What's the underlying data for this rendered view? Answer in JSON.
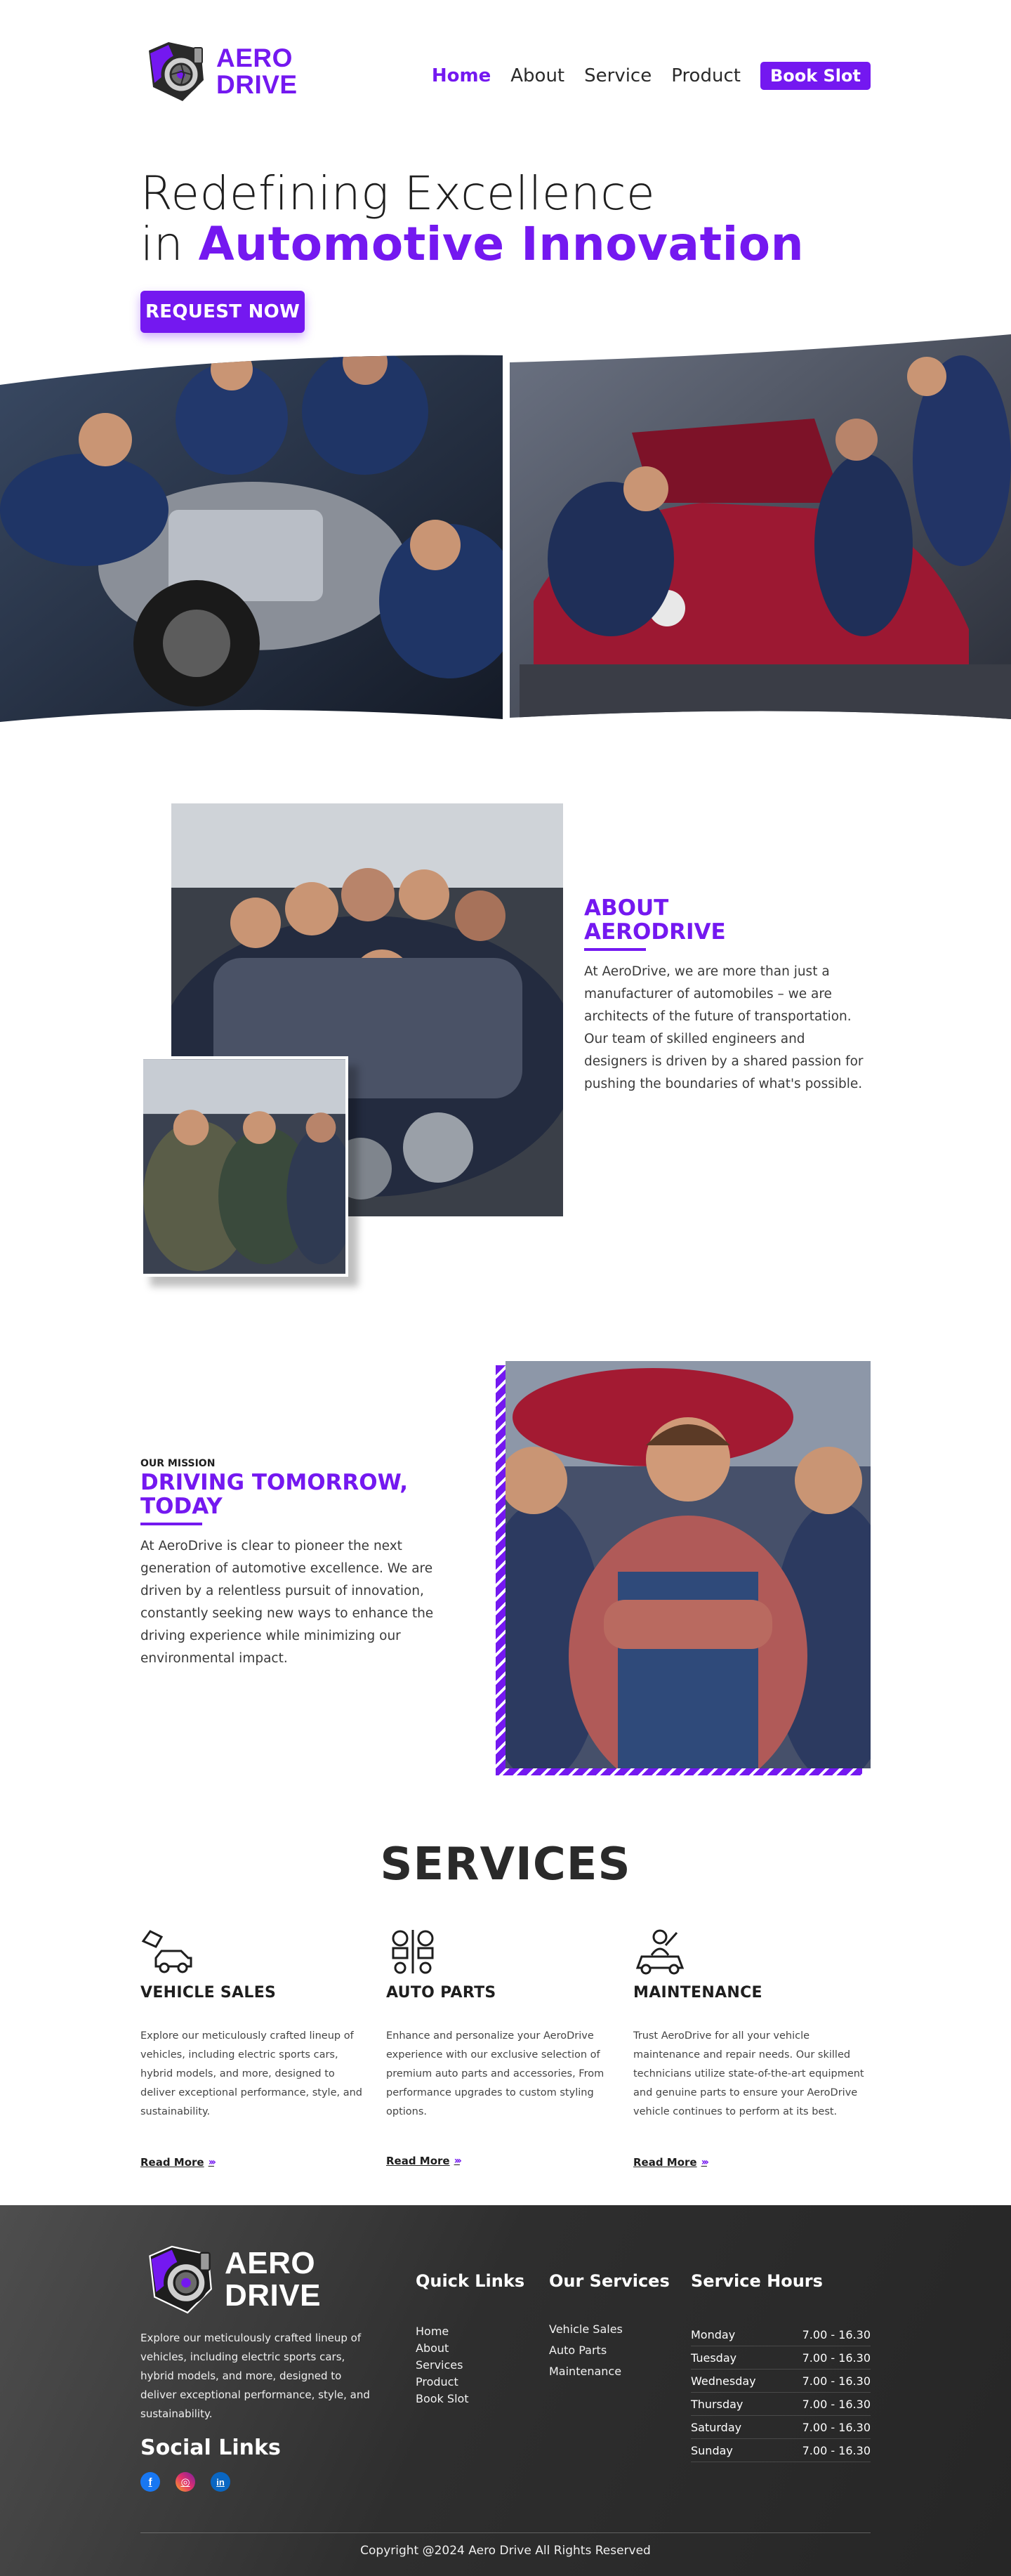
{
  "brand": {
    "line1": "AERO",
    "line2": "DRIVE",
    "accent_color": "#7418f0"
  },
  "nav": {
    "items": [
      {
        "label": "Home",
        "active": true
      },
      {
        "label": "About",
        "active": false
      },
      {
        "label": "Service",
        "active": false
      },
      {
        "label": "Product",
        "active": false
      }
    ],
    "cta": "Book Slot"
  },
  "hero": {
    "title_line1": "Redefining Excellence",
    "title_prefix": "in ",
    "title_accent": "Automotive Innovation",
    "button": "REQUEST NOW"
  },
  "about": {
    "title_line1": "ABOUT",
    "title_line2": "AERODRIVE",
    "body": "At AeroDrive, we are more than just a manufacturer of automobiles – we are architects of the future of transportation. Our team of skilled engineers and designers is driven by a shared passion for pushing the boundaries of what's possible."
  },
  "mission": {
    "eyebrow": "OUR MISSION",
    "title_line1": "DRIVING TOMORROW,",
    "title_line2": "TODAY",
    "body": "At AeroDrive is clear to pioneer the next generation of automotive excellence. We are driven by a relentless pursuit of innovation, constantly seeking new ways to enhance the driving experience while minimizing our environmental impact."
  },
  "services": {
    "heading": "SERVICES",
    "items": [
      {
        "icon": "car-sales-icon",
        "title": "VEHICLE SALES",
        "body": "Explore our meticulously crafted lineup of vehicles, including electric sports cars, hybrid models, and more, designed to deliver exceptional performance, style, and sustainability.",
        "link": "Read More"
      },
      {
        "icon": "auto-parts-icon",
        "title": "AUTO PARTS",
        "body": "Enhance and personalize your AeroDrive experience with our exclusive selection of premium auto parts and accessories, From performance upgrades to custom styling options.",
        "link": "Read More"
      },
      {
        "icon": "mechanic-icon",
        "title": "MAINTENANCE",
        "body": "Trust AeroDrive for all your vehicle maintenance and repair needs. Our skilled technicians utilize state-of-the-art equipment and genuine parts to ensure your AeroDrive vehicle continues to perform at its best.",
        "link": "Read More"
      }
    ]
  },
  "footer": {
    "about": "Explore our meticulously crafted lineup of vehicles, including electric sports cars, hybrid models, and more, designed to deliver exceptional performance, style, and sustainability.",
    "social_title": "Social Links",
    "social": [
      {
        "icon": "facebook-icon",
        "glyph": "f",
        "color": "#1877f2"
      },
      {
        "icon": "instagram-icon",
        "glyph": "◎",
        "color": "#e1306c"
      },
      {
        "icon": "linkedin-icon",
        "glyph": "in",
        "color": "#0a66c2"
      }
    ],
    "quick_links_title": "Quick Links",
    "quick_links": [
      "Home",
      "About",
      "Services",
      "Product",
      "Book Slot"
    ],
    "services_title": "Our Services",
    "services_links": [
      "Vehicle Sales",
      "Auto Parts",
      "Maintenance"
    ],
    "hours_title": "Service Hours",
    "hours": [
      {
        "day": "Monday",
        "time": "7.00 - 16.30"
      },
      {
        "day": "Tuesday",
        "time": "7.00 - 16.30"
      },
      {
        "day": "Wednesday",
        "time": "7.00 - 16.30"
      },
      {
        "day": "Thursday",
        "time": "7.00 - 16.30"
      },
      {
        "day": "Saturday",
        "time": "7.00 - 16.30"
      },
      {
        "day": "Sunday",
        "time": "7.00 - 16.30"
      }
    ],
    "copyright": "Copyright @2024 Aero Drive All Rights Reserved"
  }
}
